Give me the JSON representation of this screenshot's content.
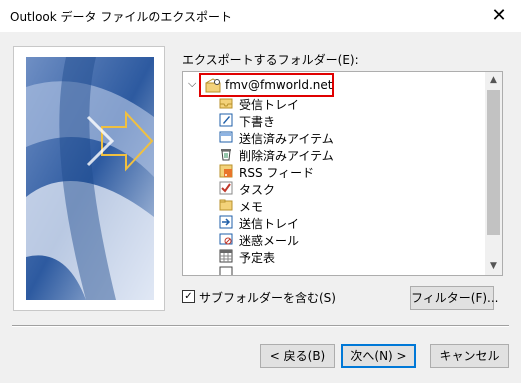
{
  "window": {
    "title": "Outlook データ ファイルのエクスポート",
    "close_glyph": "✕"
  },
  "folders": {
    "label": "エクスポートするフォルダー(E):",
    "root": "fmv@fmworld.net",
    "items": [
      {
        "label": "受信トレイ",
        "icon": "inbox-icon"
      },
      {
        "label": "下書き",
        "icon": "drafts-icon"
      },
      {
        "label": "送信済みアイテム",
        "icon": "sent-items-icon"
      },
      {
        "label": "削除済みアイテム",
        "icon": "deleted-items-icon"
      },
      {
        "label": "RSS フィード",
        "icon": "rss-icon"
      },
      {
        "label": "タスク",
        "icon": "tasks-icon"
      },
      {
        "label": "メモ",
        "icon": "notes-icon"
      },
      {
        "label": "送信トレイ",
        "icon": "outbox-icon"
      },
      {
        "label": "迷惑メール",
        "icon": "junk-mail-icon"
      },
      {
        "label": "予定表",
        "icon": "calendar-icon"
      }
    ]
  },
  "options": {
    "include_subfolders_label": "サブフォルダーを含む(S)",
    "include_subfolders_checked": true,
    "filter_button": "フィルター(F)..."
  },
  "buttons": {
    "back": "< 戻る(B)",
    "next": "次へ(N) >",
    "cancel": "キャンセル"
  },
  "colors": {
    "highlight_border": "#e00000",
    "default_button_border": "#0078d7"
  }
}
